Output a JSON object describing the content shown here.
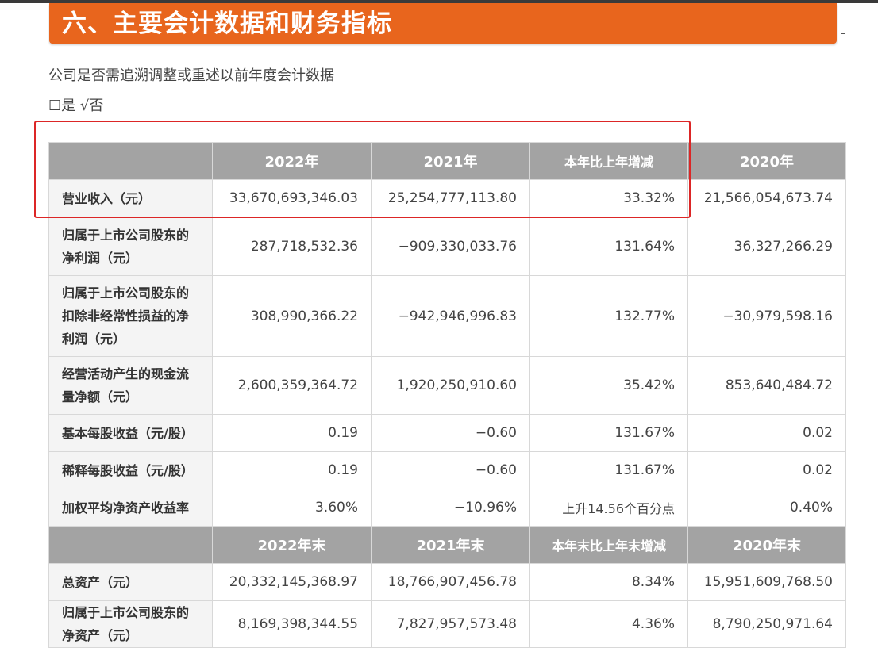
{
  "section_title": "六、主要会计数据和财务指标",
  "restatement": {
    "question": "公司是否需追溯调整或重述以前年度会计数据",
    "answer": "☐是 √否"
  },
  "table": {
    "header1": [
      "",
      "2022年",
      "2021年",
      "本年比上年增减",
      "2020年"
    ],
    "rows1": [
      {
        "label": "营业收入（元）",
        "values": [
          "33,670,693,346.03",
          "25,254,777,113.80",
          "33.32%",
          "21,566,054,673.74"
        ]
      },
      {
        "label": "归属于上市公司股东的净利润（元）",
        "values": [
          "287,718,532.36",
          "−909,330,033.76",
          "131.64%",
          "36,327,266.29"
        ]
      },
      {
        "label": "归属于上市公司股东的扣除非经常性损益的净利润（元）",
        "values": [
          "308,990,366.22",
          "−942,946,996.83",
          "132.77%",
          "−30,979,598.16"
        ]
      },
      {
        "label": "经营活动产生的现金流量净额（元）",
        "values": [
          "2,600,359,364.72",
          "1,920,250,910.60",
          "35.42%",
          "853,640,484.72"
        ]
      },
      {
        "label": "基本每股收益（元/股）",
        "values": [
          "0.19",
          "−0.60",
          "131.67%",
          "0.02"
        ]
      },
      {
        "label": "稀释每股收益（元/股）",
        "values": [
          "0.19",
          "−0.60",
          "131.67%",
          "0.02"
        ]
      },
      {
        "label": "加权平均净资产收益率",
        "values": [
          "3.60%",
          "−10.96%",
          "上升14.56个百分点",
          "0.40%"
        ]
      }
    ],
    "header2": [
      "",
      "2022年末",
      "2021年末",
      "本年末比上年末增减",
      "2020年末"
    ],
    "rows2": [
      {
        "label": "总资产（元）",
        "values": [
          "20,332,145,368.97",
          "18,766,907,456.78",
          "8.34%",
          "15,951,609,768.50"
        ]
      },
      {
        "label": "归属于上市公司股东的净资产（元）",
        "values": [
          "8,169,398,344.55",
          "7,827,957,573.48",
          "4.36%",
          "8,790,250,971.64"
        ]
      }
    ]
  },
  "colors": {
    "banner": "#e8651d",
    "header_bg": "#a3a3a3",
    "highlight_box": "#dc2626"
  }
}
